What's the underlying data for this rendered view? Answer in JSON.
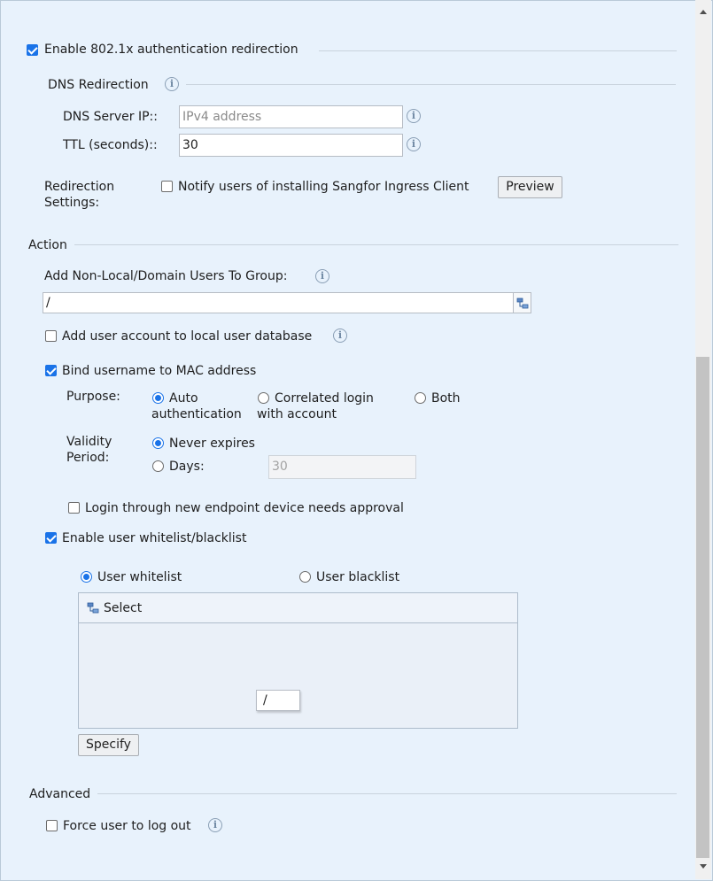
{
  "auth": {
    "enable_8021x_label": "Enable 802.1x authentication redirection",
    "enable_8021x_checked": true
  },
  "dns": {
    "section_title": "DNS Redirection",
    "server_ip_label": "DNS Server IP::",
    "server_ip_placeholder": "IPv4 address",
    "server_ip_value": "",
    "ttl_label": "TTL (seconds)::",
    "ttl_value": "30"
  },
  "redirection": {
    "label_line1": "Redirection",
    "label_line2": "Settings:",
    "notify_label": "Notify users of installing Sangfor Ingress Client",
    "notify_checked": false,
    "preview_button": "Preview"
  },
  "action": {
    "section_title": "Action",
    "add_group_label": "Add Non-Local/Domain Users To Group:",
    "group_value": "/",
    "add_local_label": "Add user account to local user database",
    "add_local_checked": false,
    "bind_mac_label": "Bind username to MAC address",
    "bind_mac_checked": true,
    "purpose_label": "Purpose:",
    "purpose_options": [
      {
        "line1": "Auto",
        "line2": "authentication",
        "checked": true
      },
      {
        "line1": "Correlated login",
        "line2": "with account",
        "checked": false
      },
      {
        "line1": "Both",
        "line2": "",
        "checked": false
      }
    ],
    "validity_label_line1": "Validity",
    "validity_label_line2": "Period:",
    "never_expires_label": "Never expires",
    "never_expires_checked": true,
    "days_label": "Days:",
    "days_checked": false,
    "days_value": "30",
    "approval_label": "Login through new endpoint device needs approval",
    "approval_checked": false,
    "whitelist_enable_label": "Enable user whitelist/blacklist",
    "whitelist_enable_checked": true,
    "whitelist_label": "User whitelist",
    "whitelist_checked": true,
    "blacklist_label": "User blacklist",
    "blacklist_checked": false,
    "select_label": "Select",
    "path_value": "/",
    "specify_button": "Specify"
  },
  "advanced": {
    "section_title": "Advanced",
    "force_logout_label": "Force user to log out",
    "force_logout_checked": false
  },
  "icons": {
    "info": "info-icon",
    "tree": "tree-select-icon"
  },
  "colors": {
    "accent": "#1a73e8",
    "panel_bg": "#e8f2fc"
  }
}
